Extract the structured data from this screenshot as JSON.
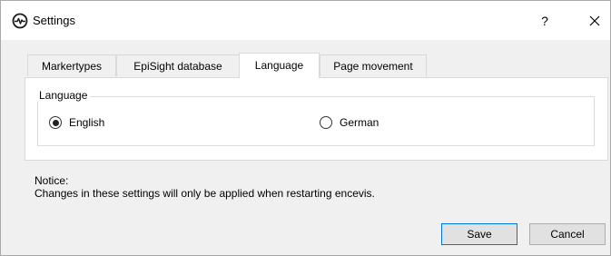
{
  "window": {
    "title": "Settings",
    "help_label": "?",
    "close_label": "✕"
  },
  "tabs": [
    {
      "label": "Markertypes",
      "active": false
    },
    {
      "label": "EpiSight database",
      "active": false
    },
    {
      "label": "Language",
      "active": true
    },
    {
      "label": "Page movement",
      "active": false
    }
  ],
  "language_group": {
    "title": "Language",
    "options": [
      {
        "label": "English",
        "selected": true
      },
      {
        "label": "German",
        "selected": false
      }
    ]
  },
  "notice": {
    "heading": "Notice:",
    "text": "Changes in these settings will only be applied when restarting encevis."
  },
  "buttons": {
    "save_label": "Save",
    "cancel_label": "Cancel"
  },
  "colors": {
    "accent": "#0078d7",
    "button_bg": "#e1e1e1",
    "dialog_bg": "#f0f0f0"
  },
  "icons": {
    "app": "heartbeat-icon",
    "close": "close-icon"
  }
}
